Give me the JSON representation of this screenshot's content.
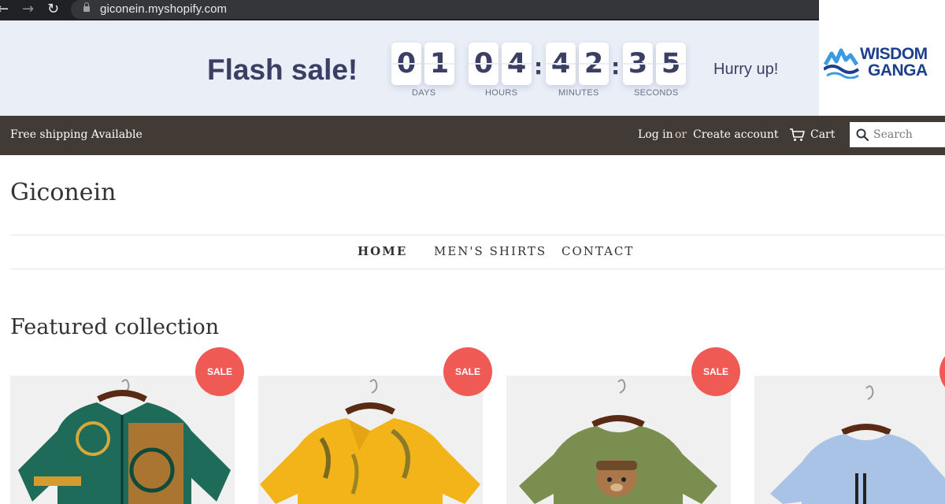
{
  "browser": {
    "url": "giconein.myshopify.com"
  },
  "logo": {
    "line1": "WISDOM",
    "line2": "GANGA",
    "colors": {
      "text": "#1d3f8f",
      "wave": "#3b9ae0"
    }
  },
  "flash": {
    "title": "Flash sale!",
    "digits": {
      "days": [
        "0",
        "1"
      ],
      "hours": [
        "0",
        "4"
      ],
      "minutes": [
        "4",
        "2"
      ],
      "seconds": [
        "3",
        "5"
      ]
    },
    "labels": {
      "days": "DAYS",
      "hours": "HOURS",
      "minutes": "MINUTES",
      "seconds": "SECONDS"
    },
    "hurry": "Hurry up!",
    "colors": {
      "bg": "#e9eef7",
      "text": "#3a3f63"
    }
  },
  "header": {
    "free_shipping": "Free shipping Available",
    "login": "Log in",
    "or": "or",
    "create_account": "Create account",
    "cart": "Cart",
    "search_placeholder": "Search",
    "colors": {
      "bg": "#413a35"
    }
  },
  "store": {
    "title": "Giconein"
  },
  "nav": {
    "items": [
      {
        "label": "HOME",
        "active": true
      },
      {
        "label": "MEN'S SHIRTS",
        "active": false
      },
      {
        "label": "CONTACT",
        "active": false
      }
    ]
  },
  "featured": {
    "heading": "Featured collection",
    "products": [
      {
        "badge": "SALE",
        "image": "green patterned button-up shirt on hanger"
      },
      {
        "badge": "SALE",
        "image": "yellow floral Hawaiian shirt on hanger"
      },
      {
        "badge": "SALE",
        "image": "olive green t-shirt with teddy bear print on hanger"
      },
      {
        "badge": "",
        "image": "light blue t-shirt on hanger"
      }
    ],
    "colors": {
      "sale": "#ef5a55"
    }
  }
}
